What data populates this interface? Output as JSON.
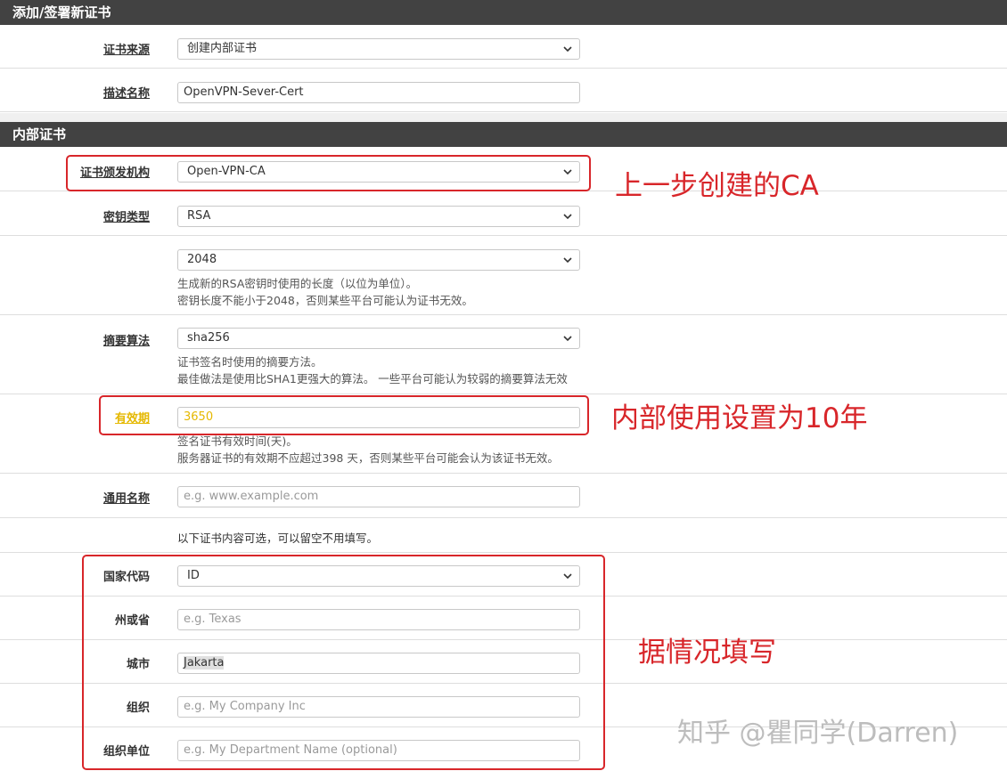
{
  "sections": {
    "add_sign": "添加/签署新证书",
    "internal": "内部证书"
  },
  "cert_source": {
    "label": "证书来源",
    "value": "创建内部证书"
  },
  "description": {
    "label": "描述名称",
    "value": "OpenVPN-Sever-Cert"
  },
  "issuer": {
    "label": "证书颁发机构",
    "value": "Open-VPN-CA"
  },
  "key_type": {
    "label": "密钥类型",
    "value": "RSA"
  },
  "key_length": {
    "value": "2048",
    "help1": "生成新的RSA密钥时使用的长度（以位为单位）。",
    "help2": "密钥长度不能小于2048，否则某些平台可能认为证书无效。"
  },
  "digest": {
    "label": "摘要算法",
    "value": "sha256",
    "help1": "证书签名时使用的摘要方法。",
    "help2": "最佳做法是使用比SHA1更强大的算法。 一些平台可能认为较弱的摘要算法无效"
  },
  "lifetime": {
    "label": "有效期",
    "value": "3650",
    "help1": "签名证书有效时间(天)。",
    "help2": "服务器证书的有效期不应超过398 天，否则某些平台可能会认为该证书无效。"
  },
  "common_name": {
    "label": "通用名称",
    "placeholder": "e.g. www.example.com"
  },
  "optional_note": "以下证书内容可选，可以留空不用填写。",
  "country": {
    "label": "国家代码",
    "value": "ID"
  },
  "state": {
    "label": "州或省",
    "placeholder": "e.g. Texas"
  },
  "city": {
    "label": "城市",
    "value": "Jakarta"
  },
  "org": {
    "label": "组织",
    "placeholder": "e.g. My Company Inc"
  },
  "org_unit": {
    "label": "组织单位",
    "placeholder": "e.g. My Department Name (optional)"
  },
  "annotations": {
    "ca": "上一步创建的CA",
    "ten_years": "内部使用设置为10年",
    "fill": "据情况填写"
  },
  "watermark": "知乎 @瞿同学(Darren)",
  "colors": {
    "header_bg": "#424242",
    "annotation_red": "#d8262a",
    "warning_yellow": "#e5b800"
  }
}
